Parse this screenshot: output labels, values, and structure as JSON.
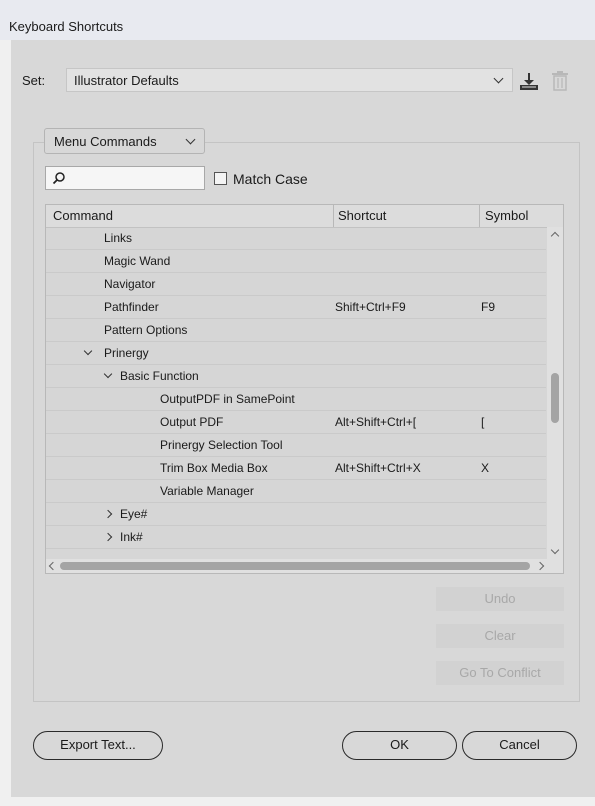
{
  "window": {
    "title": "Keyboard Shortcuts"
  },
  "set": {
    "label": "Set:",
    "value": "Illustrator Defaults"
  },
  "commands_dropdown": {
    "value": "Menu Commands"
  },
  "search": {
    "value": "",
    "placeholder": ""
  },
  "match_case": {
    "label": "Match Case",
    "checked": false
  },
  "table": {
    "columns": [
      "Command",
      "Shortcut",
      "Symbol"
    ],
    "rows": [
      {
        "indent": 1,
        "toggle": "",
        "command": "Links",
        "shortcut": "",
        "symbol": ""
      },
      {
        "indent": 1,
        "toggle": "",
        "command": "Magic Wand",
        "shortcut": "",
        "symbol": ""
      },
      {
        "indent": 1,
        "toggle": "",
        "command": "Navigator",
        "shortcut": "",
        "symbol": ""
      },
      {
        "indent": 1,
        "toggle": "",
        "command": "Pathfinder",
        "shortcut": "Shift+Ctrl+F9",
        "symbol": "F9"
      },
      {
        "indent": 1,
        "toggle": "",
        "command": "Pattern Options",
        "shortcut": "",
        "symbol": ""
      },
      {
        "indent": 1,
        "toggle": "down",
        "command": "Prinergy",
        "shortcut": "",
        "symbol": ""
      },
      {
        "indent": 2,
        "toggle": "down",
        "command": "Basic Function",
        "shortcut": "",
        "symbol": ""
      },
      {
        "indent": 3,
        "toggle": "",
        "command": "OutputPDF in SamePoint",
        "shortcut": "",
        "symbol": ""
      },
      {
        "indent": 3,
        "toggle": "",
        "command": "Output PDF",
        "shortcut": "Alt+Shift+Ctrl+[",
        "symbol": "["
      },
      {
        "indent": 3,
        "toggle": "",
        "command": "Prinergy Selection Tool",
        "shortcut": "",
        "symbol": ""
      },
      {
        "indent": 3,
        "toggle": "",
        "command": "Trim Box  Media Box",
        "shortcut": "Alt+Shift+Ctrl+X",
        "symbol": "X"
      },
      {
        "indent": 3,
        "toggle": "",
        "command": "Variable Manager",
        "shortcut": "",
        "symbol": ""
      },
      {
        "indent": 2,
        "toggle": "right",
        "command": "Eye#",
        "shortcut": "",
        "symbol": ""
      },
      {
        "indent": 2,
        "toggle": "right",
        "command": "Ink#",
        "shortcut": "",
        "symbol": ""
      }
    ]
  },
  "side_buttons": {
    "undo": "Undo",
    "clear": "Clear",
    "conflict": "Go To Conflict"
  },
  "footer": {
    "export": "Export Text...",
    "ok": "OK",
    "cancel": "Cancel"
  },
  "icons": {
    "save": "save-set-icon",
    "delete": "delete-set-icon",
    "search": "search-icon"
  },
  "colors": {
    "dialog_bg": "#d8d8d8",
    "disabled_text": "#a8a8a8"
  }
}
